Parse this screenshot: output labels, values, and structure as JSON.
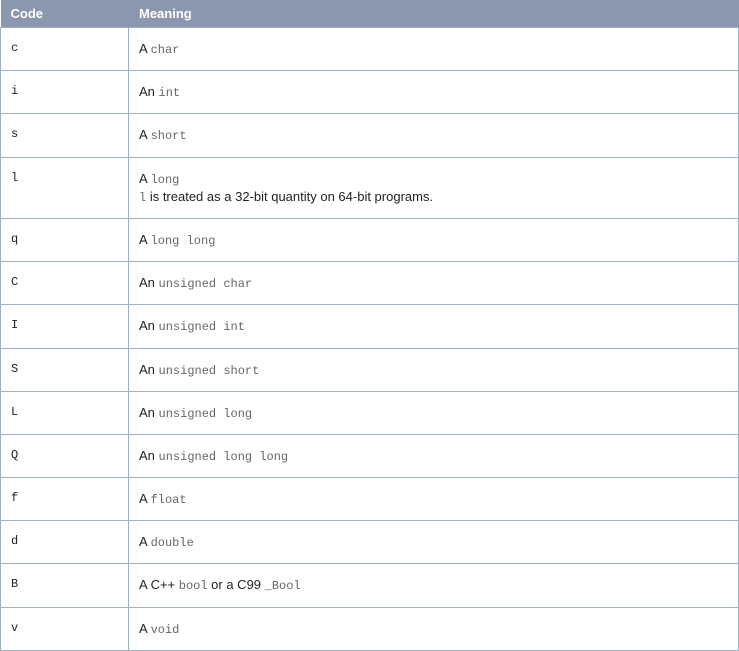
{
  "table": {
    "headers": {
      "code": "Code",
      "meaning": "Meaning"
    },
    "rows": [
      {
        "code": "c",
        "prefix": "A ",
        "type": "char",
        "suffix": ""
      },
      {
        "code": "i",
        "prefix": "An ",
        "type": "int",
        "suffix": ""
      },
      {
        "code": "s",
        "prefix": "A ",
        "type": "short",
        "suffix": ""
      },
      {
        "code": "l",
        "prefix": "A ",
        "type": "long",
        "suffix": "",
        "extra_code": "l",
        "extra_text": " is treated as a 32-bit quantity on 64-bit programs."
      },
      {
        "code": "q",
        "prefix": "A ",
        "type": "long long",
        "suffix": ""
      },
      {
        "code": "C",
        "prefix": "An ",
        "type": "unsigned char",
        "suffix": ""
      },
      {
        "code": "I",
        "prefix": "An ",
        "type": "unsigned int",
        "suffix": ""
      },
      {
        "code": "S",
        "prefix": "An ",
        "type": "unsigned short",
        "suffix": ""
      },
      {
        "code": "L",
        "prefix": "An ",
        "type": "unsigned long",
        "suffix": ""
      },
      {
        "code": "Q",
        "prefix": "An ",
        "type": "unsigned long long",
        "suffix": ""
      },
      {
        "code": "f",
        "prefix": "A ",
        "type": "float",
        "suffix": ""
      },
      {
        "code": "d",
        "prefix": "A ",
        "type": "double",
        "suffix": ""
      },
      {
        "code": "B",
        "prefix": "A C++ ",
        "type": "bool",
        "mid": " or a C99 ",
        "type2": "_Bool",
        "suffix": ""
      },
      {
        "code": "v",
        "prefix": "A ",
        "type": "void",
        "suffix": ""
      }
    ]
  }
}
